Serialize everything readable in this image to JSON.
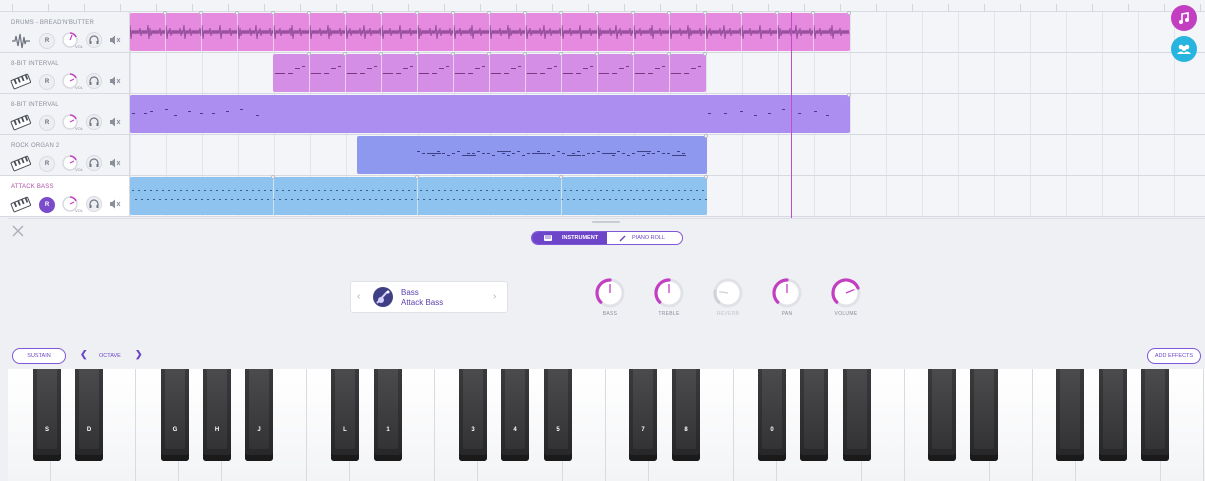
{
  "tracks": [
    {
      "name": "DRUMS - BREAD'N'BUTTER",
      "icon": "drum-waveform-icon",
      "record": "R",
      "vol": "VOL",
      "active": false
    },
    {
      "name": "8-BIT INTERVAL",
      "icon": "keyboard-icon",
      "record": "R",
      "vol": "VOL",
      "active": false
    },
    {
      "name": "8-BIT INTERVAL",
      "icon": "keyboard-icon",
      "record": "R",
      "vol": "VOL",
      "active": false
    },
    {
      "name": "ROCK ORGAN 2",
      "icon": "keyboard-icon",
      "record": "R",
      "vol": "VOL",
      "active": false
    },
    {
      "name": "ATTACK BASS",
      "icon": "keyboard-icon",
      "record": "R",
      "vol": "VOL",
      "active": true
    }
  ],
  "colors": {
    "accent": "#6d45c8",
    "drums_clip": "#e68ae0",
    "bit_clip": "#d58ee6",
    "bit2_clip": "#ac8ef0",
    "organ_clip": "#8e98ee",
    "bass_clip": "#8ec3ef",
    "playhead": "#c24cc6",
    "fab_music": "#c23fc2",
    "fab_collab": "#27b5e0"
  },
  "panel": {
    "tab_instrument": "INSTRUMENT",
    "tab_piano_roll": "PIANO ROLL",
    "instrument_category": "Bass",
    "instrument_name": "Attack Bass",
    "knobs": [
      {
        "label": "BASS",
        "value": 0.5,
        "enabled": true
      },
      {
        "label": "TREBLE",
        "value": 0.5,
        "enabled": true
      },
      {
        "label": "REVERB",
        "value": 0.2,
        "enabled": false
      },
      {
        "label": "PAN",
        "value": 0.5,
        "enabled": true
      },
      {
        "label": "VOLUME",
        "value": 0.75,
        "enabled": true
      }
    ]
  },
  "controls": {
    "sustain": "SUSTAIN",
    "octave": "OCTAVE",
    "add_effects": "ADD EFFECTS"
  },
  "keyboard": {
    "black_key_labels": [
      "S",
      "D",
      "G",
      "H",
      "J",
      "L",
      "1",
      "3",
      "4",
      "5",
      "7",
      "8",
      "0",
      "",
      "",
      "",
      "",
      "",
      "",
      ""
    ]
  }
}
